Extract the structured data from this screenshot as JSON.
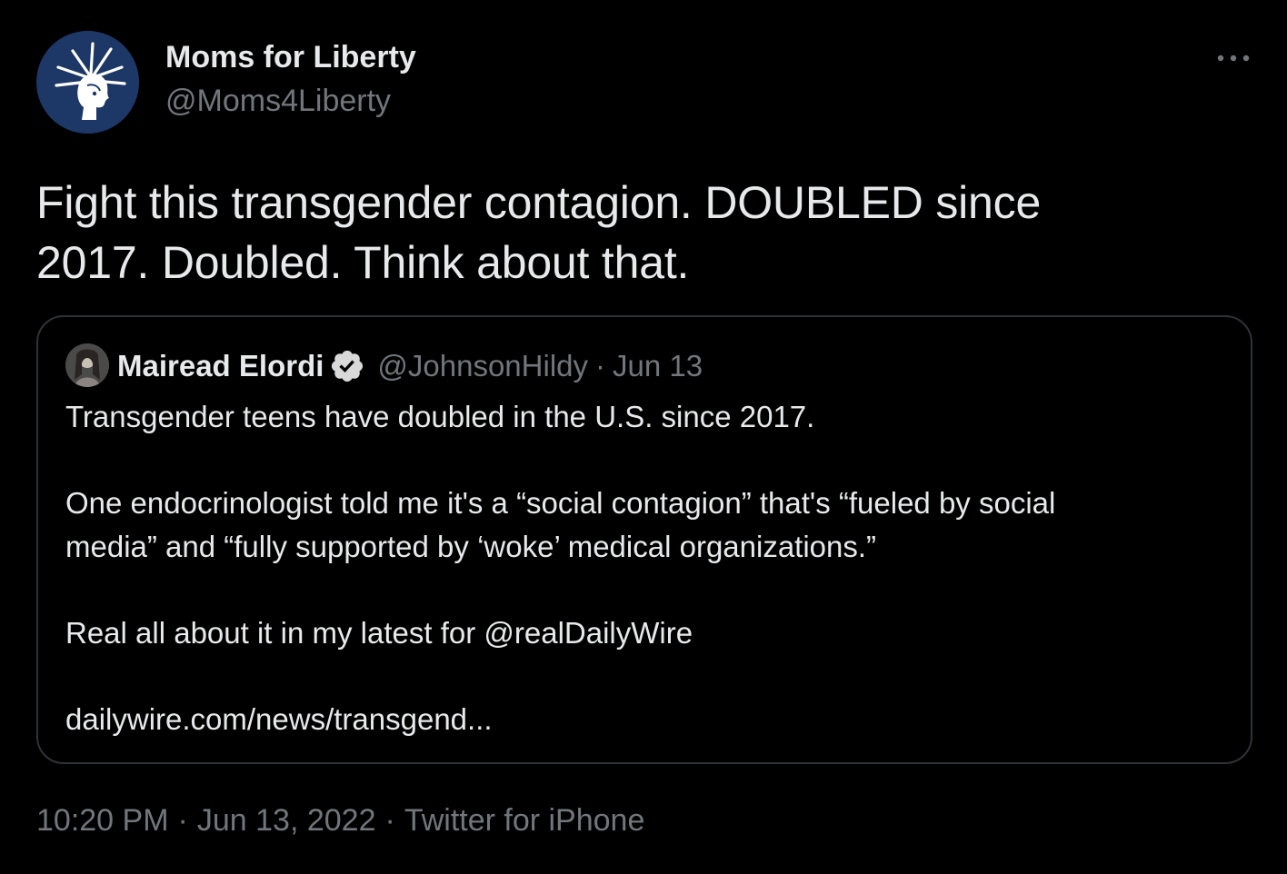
{
  "author": {
    "name": "Moms for Liberty",
    "handle": "@Moms4Liberty"
  },
  "tweet": {
    "text_line1": "Fight this transgender contagion. DOUBLED since",
    "text_line2": "2017. Doubled. Think about that."
  },
  "quoted_tweet": {
    "name": "Mairead Elordi",
    "handle": "@JohnsonHildy",
    "separator": "·",
    "date": "Jun 13",
    "paragraph1": "Transgender teens have doubled in the U.S. since 2017.",
    "paragraph2_line1": "One endocrinologist told me it's a “social contagion” that's “fueled by social",
    "paragraph2_line2": "media” and “fully supported by ‘woke’ medical organizations.”",
    "paragraph3": "Real all about it in my latest for @realDailyWire",
    "link": "dailywire.com/news/transgend..."
  },
  "meta": {
    "time": "10:20 PM",
    "separator": "·",
    "date": "Jun 13, 2022",
    "source": "Twitter for iPhone"
  },
  "icons": {
    "more": "more-horizontal-icon",
    "verified": "verified-badge-icon",
    "avatar": "statue-of-liberty-logo"
  },
  "colors": {
    "background": "#000000",
    "text_primary": "#e7e9ea",
    "text_secondary": "#71767b",
    "border": "#2f3336",
    "avatar_bg": "#1d3766"
  }
}
